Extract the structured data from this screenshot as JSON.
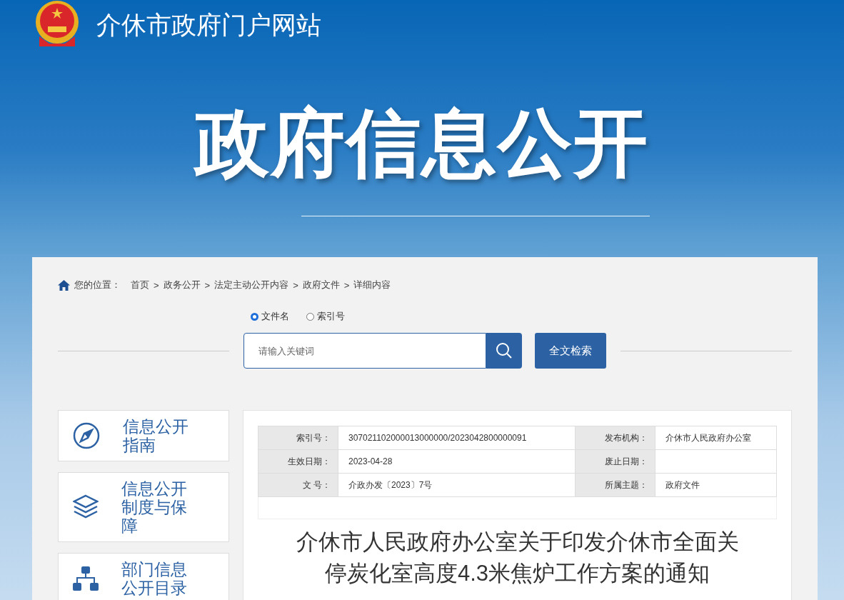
{
  "site_title": "介休市政府门户网站",
  "banner_title": "政府信息公开",
  "breadcrumb": {
    "label": "您的位置：",
    "separator": ">",
    "items": [
      "首页",
      "政务公开",
      "法定主动公开内容",
      "政府文件",
      "详细内容"
    ]
  },
  "search": {
    "options": [
      {
        "label": "文件名",
        "selected": true
      },
      {
        "label": "索引号",
        "selected": false
      }
    ],
    "placeholder": "请输入关键词",
    "button": "全文检索"
  },
  "sidebar": {
    "items": [
      {
        "label": "信息公开指南",
        "kind": "compass"
      },
      {
        "label": "信息公开制度与保障",
        "kind": "layers"
      },
      {
        "label": "部门信息公开目录",
        "kind": "org"
      }
    ]
  },
  "meta": {
    "rows": [
      {
        "label": "索引号：",
        "value": "307021102000013000000/2023042800000091",
        "label_2": "发布机构：",
        "value_2": "介休市人民政府办公室"
      },
      {
        "label": "生效日期：",
        "value": "2023-04-28",
        "label_2": "废止日期："
      },
      {
        "label": "文 号：",
        "value": "介政办发〔2023〕7号",
        "label_2": "所属主题：",
        "value_2": "政府文件"
      }
    ]
  },
  "document_title": "介休市人民政府办公室关于印发介休市全面关停炭化室高度4.3米焦炉工作方案的通知"
}
